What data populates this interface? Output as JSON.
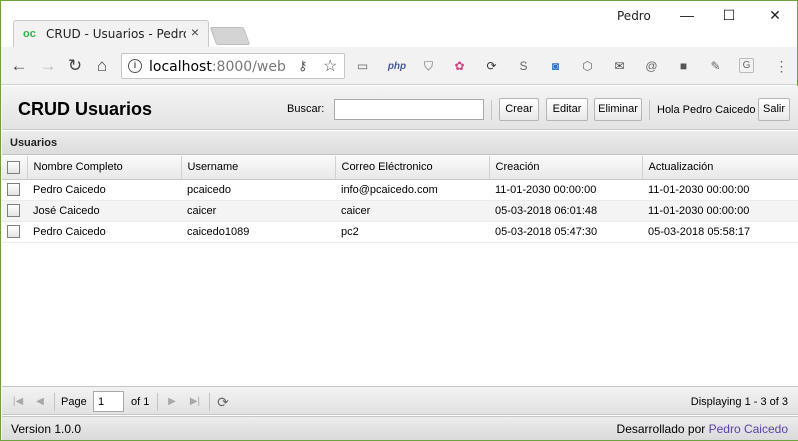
{
  "browser": {
    "tab_title": "CRUD - Usuarios - Pedro",
    "tab_favicon": "oc",
    "profile_name": "Pedro",
    "url_host": "localhost",
    "url_rest": ":8000/web",
    "extensions": [
      "cast-icon",
      "php-icon",
      "shield-icon",
      "color-wheel-icon",
      "sync-icon",
      "skype-icon",
      "compass-icon",
      "cube-icon",
      "envelope-icon",
      "at-icon",
      "square-icon",
      "feather-icon",
      "g-icon",
      "menu-dots-icon"
    ],
    "ext_php_label": "php",
    "ext_g_label": "G"
  },
  "app": {
    "title": "CRUD Usuarios",
    "search_label": "Buscar:",
    "search_value": "",
    "buttons": {
      "create": "Crear",
      "edit": "Editar",
      "delete": "Eliminar",
      "logout": "Salir"
    },
    "greeting": "Hola Pedro Caicedo"
  },
  "panel": {
    "title": "Usuarios",
    "columns": [
      "Nombre Completo",
      "Username",
      "Correo Eléctronico",
      "Creación",
      "Actualización"
    ],
    "rows": [
      {
        "name": "Pedro Caicedo",
        "username": "pcaicedo",
        "email": "info@pcaicedo.com",
        "created": "11-01-2030 00:00:00",
        "updated": "11-01-2030 00:00:00"
      },
      {
        "name": "José Caicedo",
        "username": "caicer",
        "email": "caicer",
        "created": "05-03-2018 06:01:48",
        "updated": "11-01-2030 00:00:00"
      },
      {
        "name": "Pedro Caicedo",
        "username": "caicedo1089",
        "email": "pc2",
        "created": "05-03-2018 05:47:30",
        "updated": "05-03-2018 05:58:17"
      }
    ]
  },
  "pager": {
    "page_label": "Page",
    "page_value": "1",
    "of_label": "of 1",
    "displaying": "Displaying 1 - 3 of 3"
  },
  "footer": {
    "version": "Version 1.0.0",
    "credit_prefix": "Desarrollado por",
    "credit_name": "Pedro Caicedo"
  }
}
